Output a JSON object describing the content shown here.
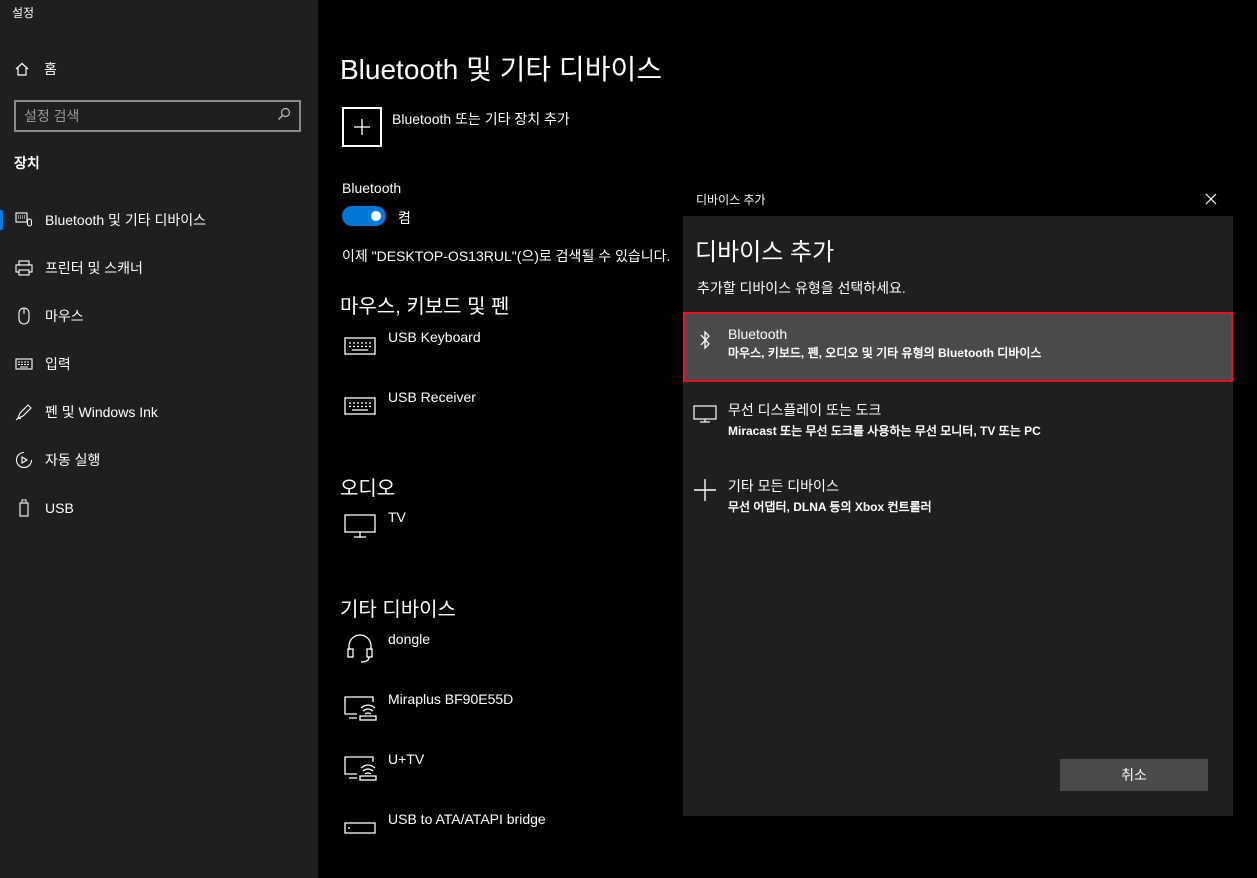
{
  "window": {
    "title": "설정"
  },
  "sidebar": {
    "home_label": "홈",
    "search_placeholder": "설정 검색",
    "section": "장치",
    "items": [
      {
        "label": "Bluetooth 및 기타 디바이스",
        "icon": "keyboard-mouse-icon"
      },
      {
        "label": "프린터 및 스캐너",
        "icon": "printer-icon"
      },
      {
        "label": "마우스",
        "icon": "mouse-icon"
      },
      {
        "label": "입력",
        "icon": "keyboard-icon"
      },
      {
        "label": "펜 및 Windows Ink",
        "icon": "pen-icon"
      },
      {
        "label": "자동 실행",
        "icon": "autoplay-icon"
      },
      {
        "label": "USB",
        "icon": "usb-icon"
      }
    ]
  },
  "main": {
    "title": "Bluetooth 및 기타 디바이스",
    "add_device_label": "Bluetooth 또는 기타 장치 추가",
    "bluetooth_label": "Bluetooth",
    "bluetooth_state": "켬",
    "discoverable_text": "이제 \"DESKTOP-OS13RUL\"(으)로 검색될 수 있습니다.",
    "sections": [
      {
        "title": "마우스, 키보드 및 펜",
        "devices": [
          "USB Keyboard",
          "USB Receiver"
        ]
      },
      {
        "title": "오디오",
        "devices": [
          "TV"
        ]
      },
      {
        "title": "기타 디바이스",
        "devices": [
          "dongle",
          "Miraplus BF90E55D",
          "U+TV",
          "USB to ATA/ATAPI bridge"
        ]
      }
    ]
  },
  "dialog": {
    "titlebar": "디바이스 추가",
    "heading": "디바이스 추가",
    "subtitle": "추가할 디바이스 유형을 선택하세요.",
    "options": [
      {
        "title": "Bluetooth",
        "desc": "마우스, 키보드, 펜, 오디오 및 기타 유형의 Bluetooth 디바이스",
        "icon": "bluetooth-icon"
      },
      {
        "title": "무선 디스플레이 또는 도크",
        "desc": "Miracast 또는 무선 도크를 사용하는 무선 모니터, TV 또는 PC",
        "icon": "monitor-icon"
      },
      {
        "title": "기타 모든 디바이스",
        "desc": "무선 어댑터, DLNA 등의 Xbox 컨트롤러",
        "icon": "plus-icon"
      }
    ],
    "cancel_label": "취소"
  },
  "colors": {
    "accent": "#0078d7",
    "highlight_border": "#e81123",
    "sidebar_bg": "#1f1f1f"
  }
}
